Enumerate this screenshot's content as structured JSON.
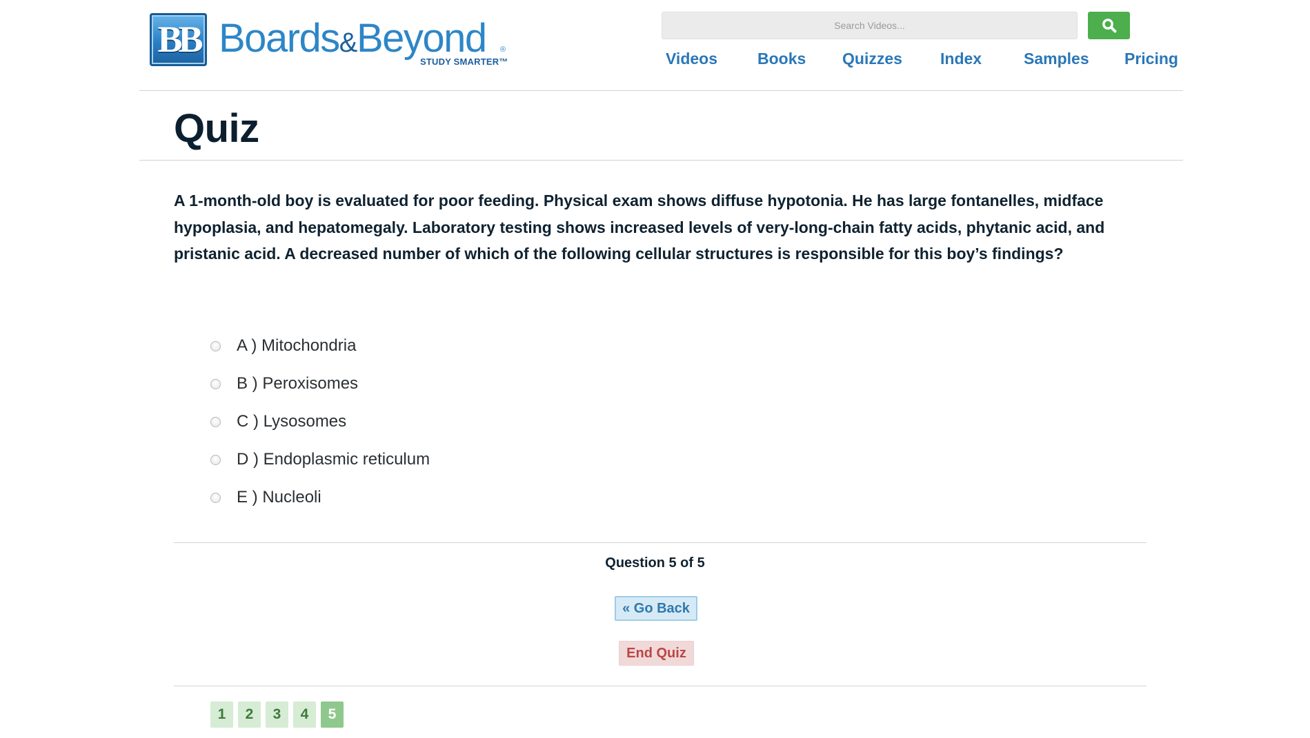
{
  "brand": {
    "mark": "BB",
    "name_part1": "Boards",
    "name_amp": "&",
    "name_part2": "Beyond",
    "registered": "®",
    "tagline": "STUDY SMARTER™"
  },
  "search": {
    "placeholder": "Search Videos...",
    "button_icon": "search-icon"
  },
  "nav": [
    {
      "label": "Videos"
    },
    {
      "label": "Books"
    },
    {
      "label": "Quizzes"
    },
    {
      "label": "Index"
    },
    {
      "label": "Samples"
    },
    {
      "label": "Pricing"
    }
  ],
  "page_title": "Quiz",
  "quiz": {
    "question": "A 1-month-old boy is evaluated for poor feeding. Physical exam shows diffuse hypotonia. He has large fontanelles, midface hypoplasia, and hepatomegaly. Laboratory testing shows increased levels of very-long-chain fatty acids, phytanic acid, and pristanic acid. A decreased number of which of the following cellular structures is responsible for this boy’s findings?",
    "options": [
      {
        "label": "A ) Mitochondria"
      },
      {
        "label": "B ) Peroxisomes"
      },
      {
        "label": "C ) Lysosomes"
      },
      {
        "label": "D ) Endoplasmic reticulum"
      },
      {
        "label": "E ) Nucleoli"
      }
    ],
    "counter": "Question 5 of 5",
    "back_label": "« Go Back",
    "end_label": "End Quiz",
    "pages": [
      {
        "label": "1"
      },
      {
        "label": "2"
      },
      {
        "label": "3"
      },
      {
        "label": "4"
      },
      {
        "label": "5"
      }
    ],
    "current_page": 5
  },
  "colors": {
    "brand_blue": "#2a77b8",
    "search_green": "#4cae4c",
    "back_bg": "#d6eaf6",
    "end_bg": "#f2d9d9",
    "page_bg": "#d6ecd4",
    "page_active_bg": "#8fc88c"
  }
}
